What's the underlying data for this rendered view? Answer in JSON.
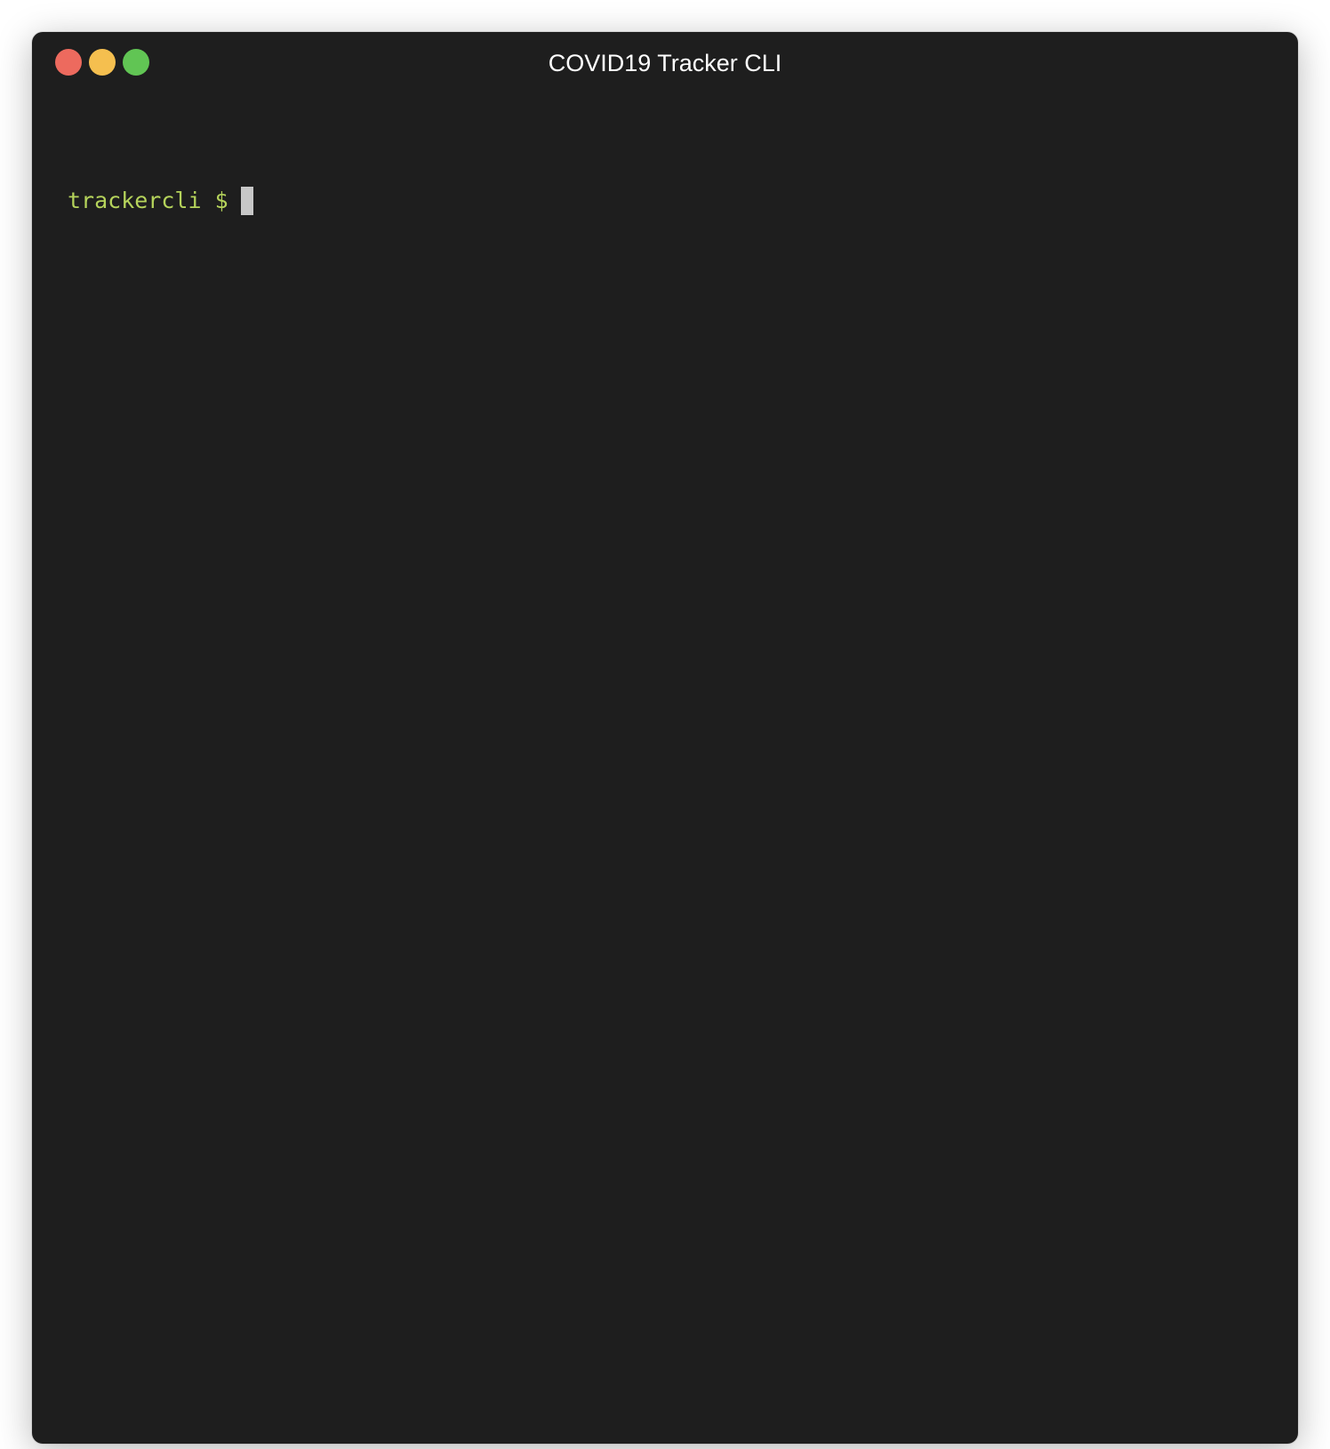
{
  "window": {
    "title": "COVID19 Tracker CLI",
    "background": "#1e1e1e",
    "buttons": {
      "close_color": "#ed6a5e",
      "minimize_color": "#f5bf4f",
      "maximize_color": "#61c554"
    }
  },
  "terminal": {
    "prompt": "trackercli $",
    "prompt_color": "#b5d35b",
    "cursor_color": "#c7c7c7",
    "input": ""
  }
}
